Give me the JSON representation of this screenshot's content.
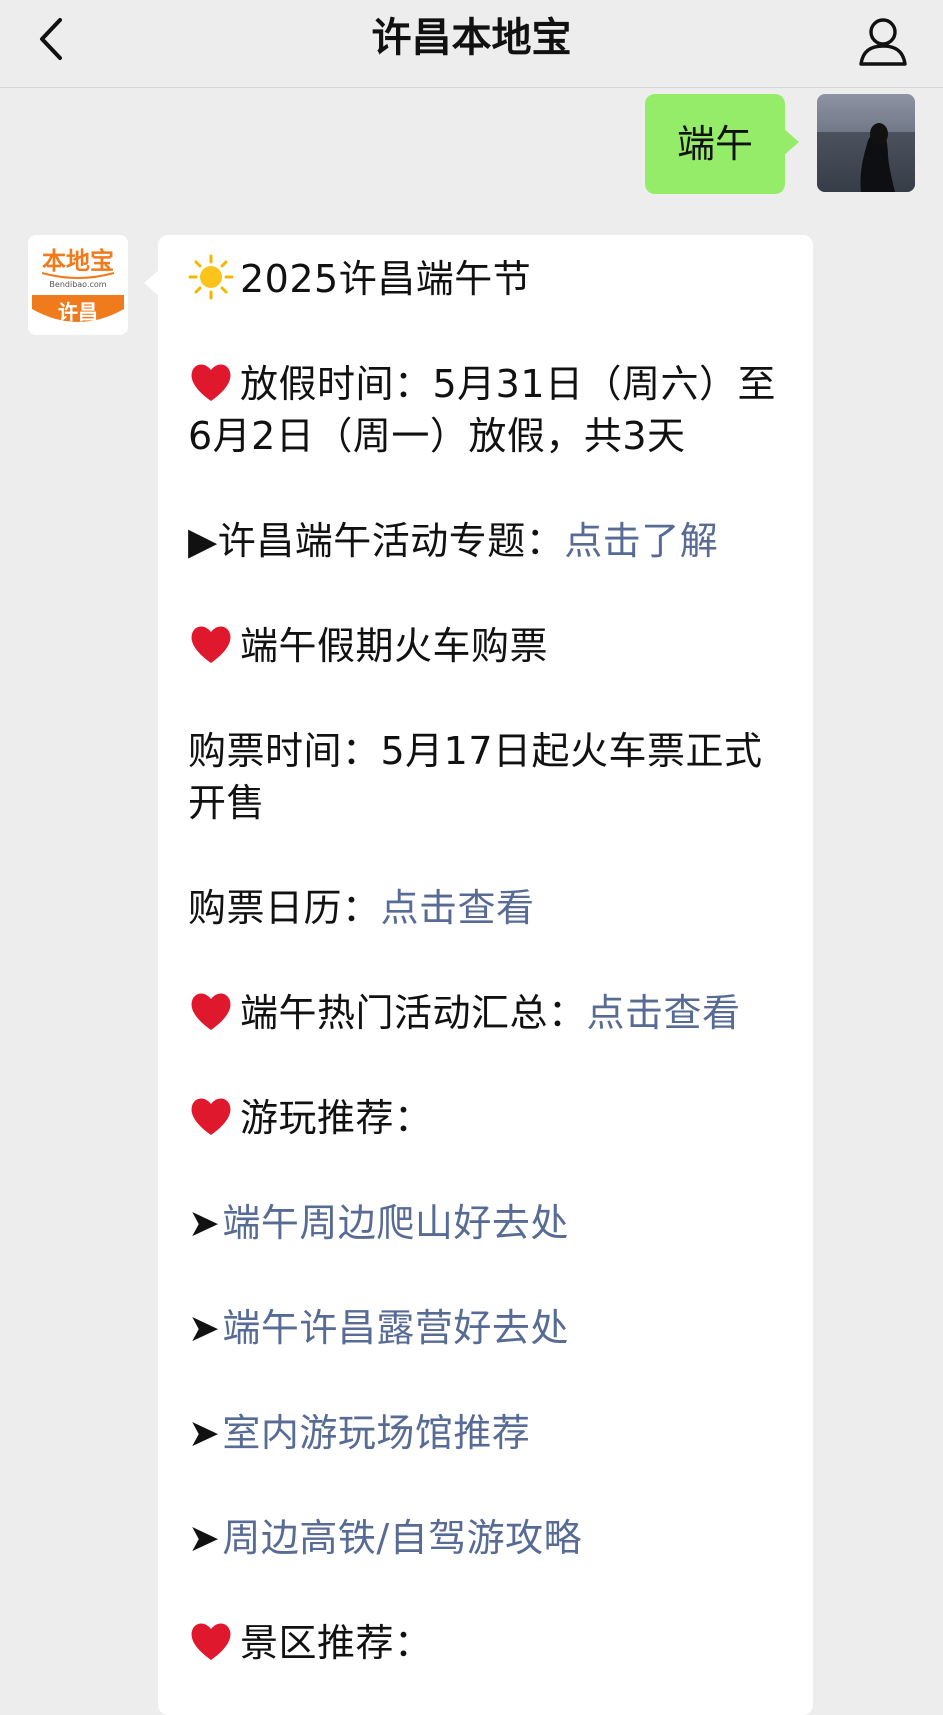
{
  "nav": {
    "back_icon": "chevron-left-icon",
    "title": "许昌本地宝",
    "profile_icon": "person-icon"
  },
  "outgoing": {
    "text": "端午",
    "avatar": "user-photo-avatar"
  },
  "incoming": {
    "avatar": {
      "logo_text": "本地宝",
      "logo_sub": "Bendibao.com",
      "logo_city": "许昌"
    },
    "lines": {
      "title": "2025许昌端午节",
      "holiday": "放假时间：5月31日（周六）至6月2日（周一）放假，共3天",
      "topic_prefix": "▶许昌端午活动专题：",
      "topic_link": "点击了解",
      "train": "端午假期火车购票",
      "ticket_time": "购票时间：5月17日起火车票正式开售",
      "calendar_prefix": "购票日历：",
      "calendar_link": "点击查看",
      "hot_prefix": "端午热门活动汇总：",
      "hot_link": "点击查看",
      "play": "游玩推荐：",
      "rec1": "端午周边爬山好去处",
      "rec2": "端午许昌露营好去处",
      "rec3": "室内游玩场馆推荐",
      "rec4": "周边高铁/自驾游攻略",
      "scenic": "景区推荐："
    }
  },
  "colors": {
    "link": "#576b95",
    "outgoing_bubble": "#95ec69",
    "background": "#ededed",
    "heart": "#e0182d",
    "sun": "#f7b500",
    "logo_orange": "#f07b1d"
  }
}
